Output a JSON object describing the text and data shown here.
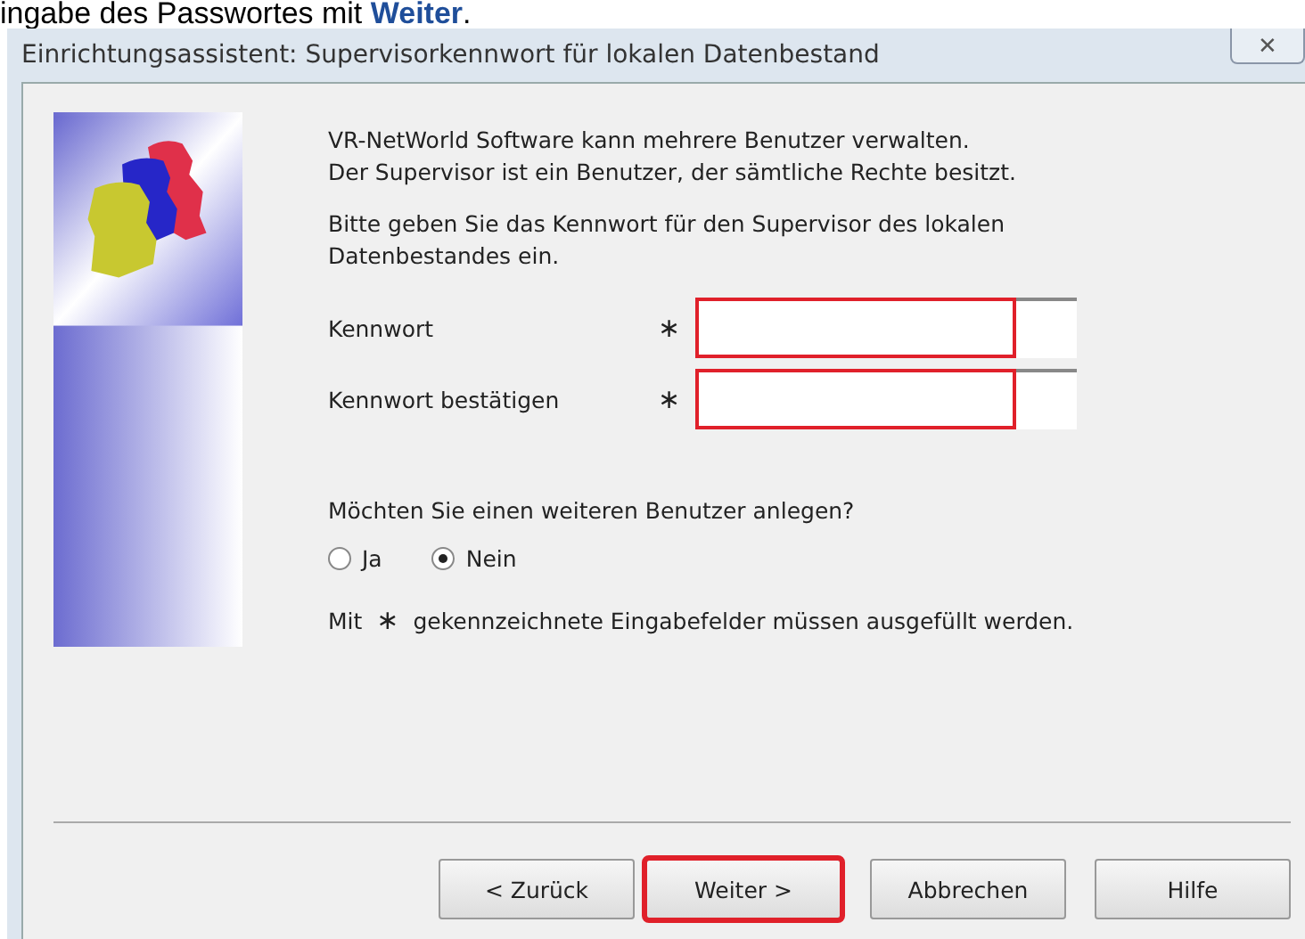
{
  "caption": "ingabe des Passwortes mit **Weiter**.",
  "window": {
    "title": "Einrichtungsassistent: Supervisorkennwort für lokalen Datenbestand",
    "close": "✕"
  },
  "intro": [
    "VR-NetWorld Software kann mehrere Benutzer verwalten.\nDer Supervisor ist ein Benutzer, der sämtliche Rechte besitzt.",
    "Bitte geben Sie das Kennwort für den Supervisor des lokalen\nDatenbestandes ein."
  ],
  "fields": [
    {
      "label": "Kennwort",
      "required": "∗",
      "highlighted": true
    },
    {
      "label": "Kennwort bestätigen",
      "required": "∗",
      "highlighted": true
    }
  ],
  "question": "Möchten Sie einen weiteren Benutzer anlegen?",
  "options": [
    {
      "label": "Ja",
      "selected": false
    },
    {
      "label": "Nein",
      "selected": true
    }
  ],
  "note": {
    "before": "Mit",
    "mark": "∗",
    "after": "gekennzeichnete Eingabefelder müssen ausgefüllt werden."
  },
  "buttons": [
    {
      "label": "< Zurück",
      "highlighted": false
    },
    {
      "label": "Weiter >",
      "highlighted": true
    },
    {
      "label": "Abbrechen",
      "highlighted": false
    },
    {
      "label": "Hilfe",
      "highlighted": false
    }
  ]
}
